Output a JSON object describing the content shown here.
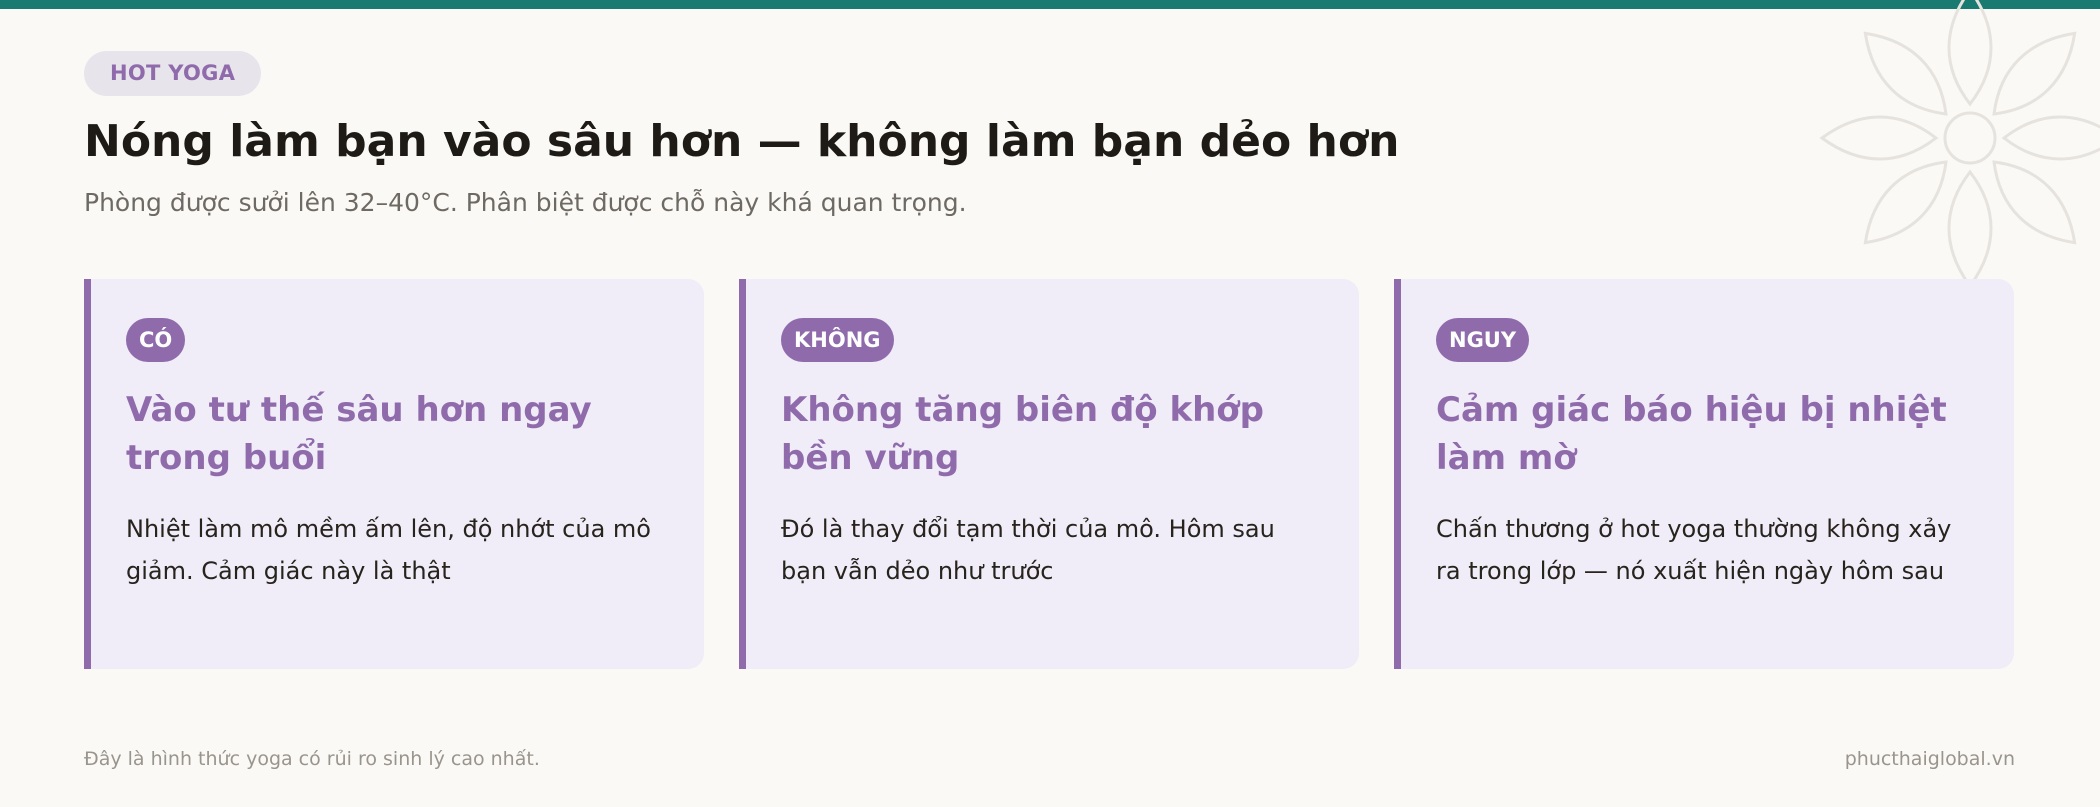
{
  "header": {
    "tag": "HOT YOGA",
    "title": "Nóng làm bạn vào sâu hơn — không làm bạn dẻo hơn",
    "subtitle": "Phòng được sưởi lên 32–40°C. Phân biệt được chỗ này khá quan trọng."
  },
  "cards": [
    {
      "badge": "CÓ",
      "heading": "Vào tư thế sâu hơn ngay trong buổi",
      "text": "Nhiệt làm mô mềm ấm lên, độ nhớt của mô giảm. Cảm giác này là thật"
    },
    {
      "badge": "KHÔNG",
      "heading": "Không tăng biên độ khớp bền vững",
      "text": "Đó là thay đổi tạm thời của mô. Hôm sau bạn vẫn dẻo như trước"
    },
    {
      "badge": "NGUY",
      "heading": "Cảm giác báo hiệu bị nhiệt làm mờ",
      "text": "Chấn thương ở hot yoga thường không xảy ra trong lớp — nó xuất hiện ngày hôm sau"
    }
  ],
  "footer": {
    "note": "Đây là hình thức yoga có rủi ro sinh lý cao nhất.",
    "site": "phucthaiglobal.vn"
  },
  "colors": {
    "accent": "#8f6bab",
    "top_bar": "#187a71",
    "card_bg": "#f0ecf8",
    "page_bg": "#faf9f6"
  },
  "icons": {
    "decoration": "lotus-flower-icon"
  }
}
